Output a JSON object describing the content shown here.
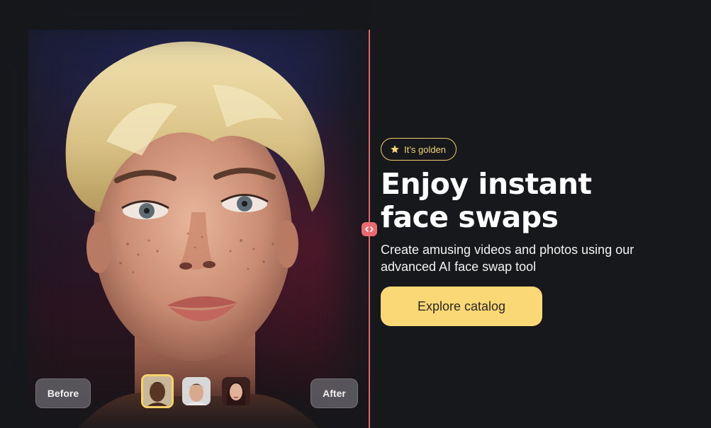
{
  "comparison": {
    "before_label": "Before",
    "after_label": "After",
    "thumbnails": [
      {
        "name": "face-thumbnail-1",
        "selected": true
      },
      {
        "name": "face-thumbnail-2",
        "selected": false
      },
      {
        "name": "face-thumbnail-3",
        "selected": false
      }
    ],
    "divider_color": "#e0656a"
  },
  "hero": {
    "badge_icon": "star-icon",
    "badge_text": "It’s golden",
    "headline_line1": "Enjoy instant",
    "headline_line2": "face swaps",
    "subtitle_line1": "Create amusing videos and photos using our",
    "subtitle_line2": "advanced AI face swap tool",
    "cta_label": "Explore catalog"
  },
  "colors": {
    "background": "#17181c",
    "accent_yellow": "#fbd876",
    "badge_border": "#f1cf6a",
    "handle": "#e96a70"
  }
}
